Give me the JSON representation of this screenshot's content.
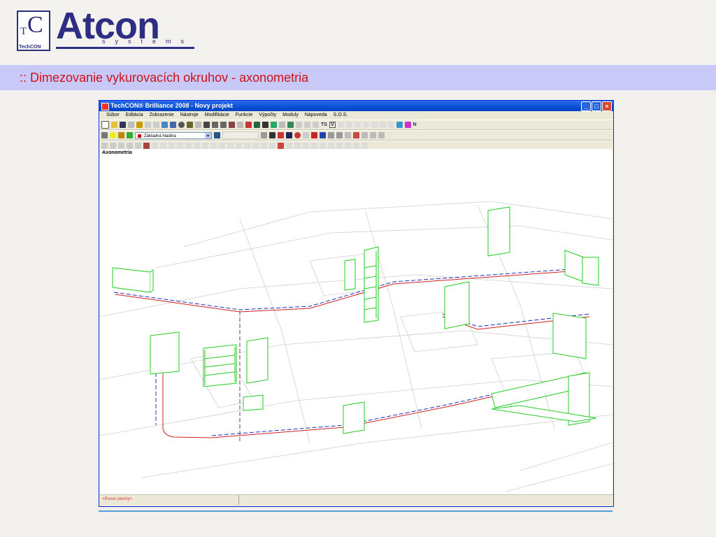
{
  "header": {
    "logo_small": {
      "top": "T",
      "big": "C",
      "caption": "TechCON"
    },
    "brand": "Atcon",
    "brand_sub": "systems",
    "slide_title": ":: Dimezovanie vykurovacích okruhov - axonometria"
  },
  "window": {
    "title": "TechCON® Brilliance 2008   - Novy projekt",
    "menu": [
      "Súbor",
      "Editácia",
      "Zobrazenie",
      "Nástroje",
      "Modifikácie",
      "Funkcie",
      "Výpočty",
      "Moduly",
      "Nápoveda",
      "S.O.S."
    ],
    "toolbar_text": {
      "ts": "TS",
      "v": "V",
      "n": "N"
    },
    "layer_select": {
      "value": "Základná hladina"
    },
    "view_label": "Axonometria",
    "status": "<Posun plochy>"
  },
  "colors": {
    "radiator": "#22cc22",
    "pipe_supply": "#d02020",
    "pipe_return": "#2030c0",
    "banner": "#c9c9f7",
    "title_red": "#d0101a"
  }
}
